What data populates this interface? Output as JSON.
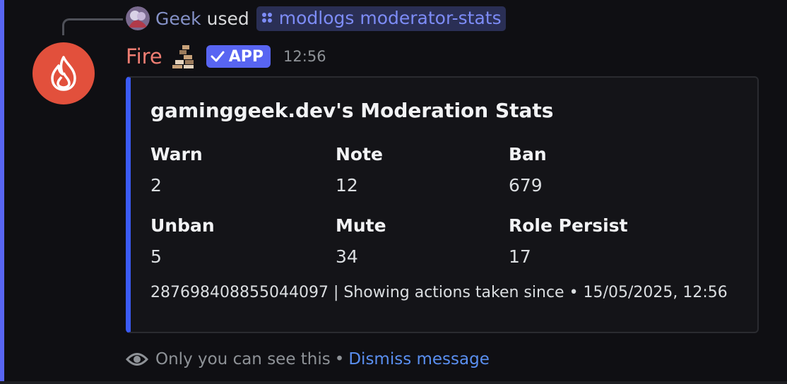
{
  "reply": {
    "user_name": "Geek",
    "verb": "used",
    "command": "modlogs moderator-stats",
    "command_icon": "slash-command-icon",
    "avatar_icon": "user-avatar"
  },
  "message": {
    "author": "Fire",
    "author_emoji": "bricks-emoji",
    "badge": "APP",
    "timestamp": "12:56",
    "avatar_icon": "flame-icon"
  },
  "embed": {
    "title": "gaminggeek.dev's Moderation Stats",
    "accent_color": "#3b5bf6",
    "fields": [
      {
        "name": "Warn",
        "value": "2"
      },
      {
        "name": "Note",
        "value": "12"
      },
      {
        "name": "Ban",
        "value": "679"
      },
      {
        "name": "Unban",
        "value": "5"
      },
      {
        "name": "Mute",
        "value": "34"
      },
      {
        "name": "Role Persist",
        "value": "17"
      }
    ],
    "footer": "287698408855044097 | Showing actions taken since • 15/05/2025, 12:56"
  },
  "ephemeral": {
    "notice": "Only you can see this",
    "separator": "•",
    "dismiss_label": "Dismiss message"
  }
}
